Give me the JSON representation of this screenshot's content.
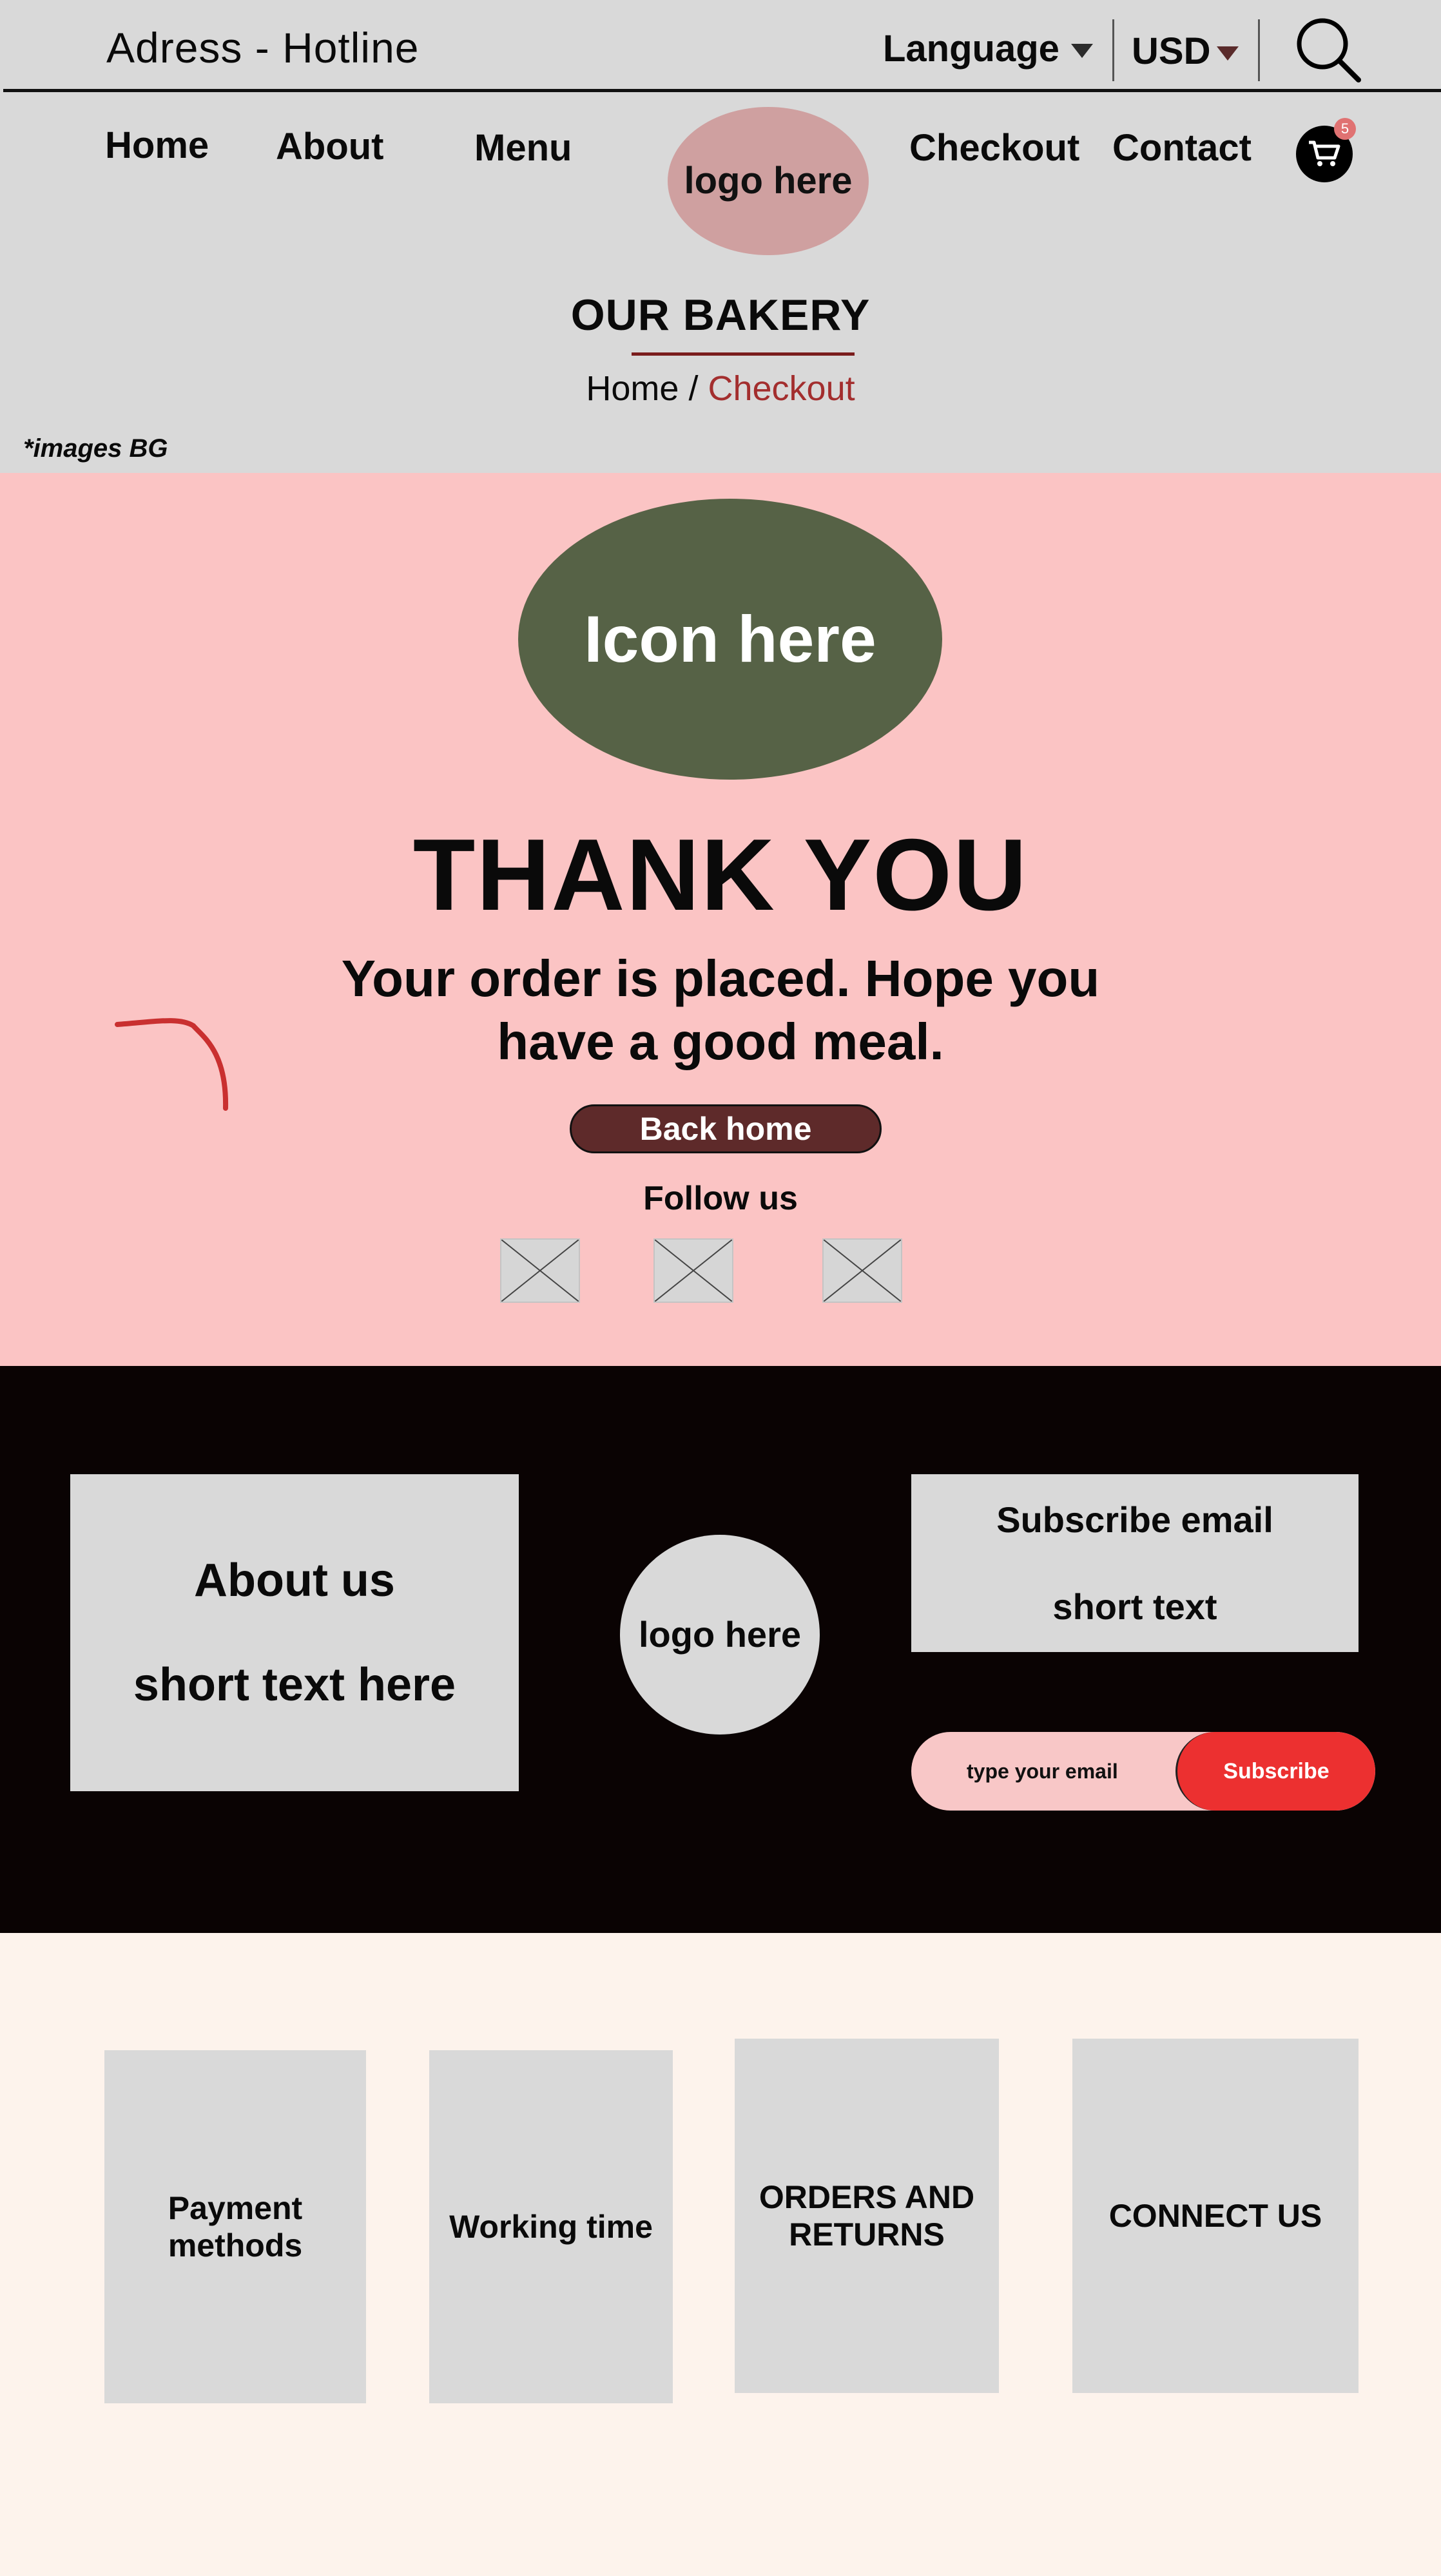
{
  "header": {
    "address_hotline": "Adress - Hotline",
    "language_label": "Language",
    "currency_label": "USD",
    "search_icon": "search-icon"
  },
  "nav": {
    "items": [
      {
        "label": "Home"
      },
      {
        "label": "About"
      },
      {
        "label": "Menu"
      },
      {
        "label": "Checkout"
      },
      {
        "label": "Contact"
      }
    ],
    "logo_text": "logo here",
    "cart_icon": "cart-icon",
    "cart_count": "5"
  },
  "page_header": {
    "title": "OUR BAKERY",
    "breadcrumb_home": "Home",
    "breadcrumb_sep": "/",
    "breadcrumb_current": "Checkout",
    "note": "*images BG"
  },
  "hero": {
    "icon_placeholder": "Icon here",
    "heading": "THANK YOU",
    "message": "Your order is placed. Hope you have a good meal.",
    "back_home_label": "Back home",
    "follow_label": "Follow us",
    "social_icons": [
      "image-placeholder-icon",
      "image-placeholder-icon",
      "image-placeholder-icon"
    ]
  },
  "footer": {
    "about_title": "About us",
    "about_text": "short text here",
    "logo_text": "logo here",
    "subscribe_title": "Subscribe email",
    "subscribe_text": "short text",
    "email_placeholder": "type your email",
    "subscribe_button": "Subscribe"
  },
  "info_cards": [
    {
      "label": "Payment methods"
    },
    {
      "label": "Working time"
    },
    {
      "label": "ORDERS AND RETURNS"
    },
    {
      "label": "CONNECT US"
    }
  ],
  "colors": {
    "header_bg": "#d9d9d9",
    "hero_bg": "#fbc4c4",
    "accent_dark_red": "#5e2a2a",
    "breadcrumb_active": "#a32e2e",
    "icon_oval": "#566246",
    "footer_dark": "#0a0303",
    "subscribe_red": "#ec3030",
    "page_bottom_bg": "#fdf3ec"
  }
}
